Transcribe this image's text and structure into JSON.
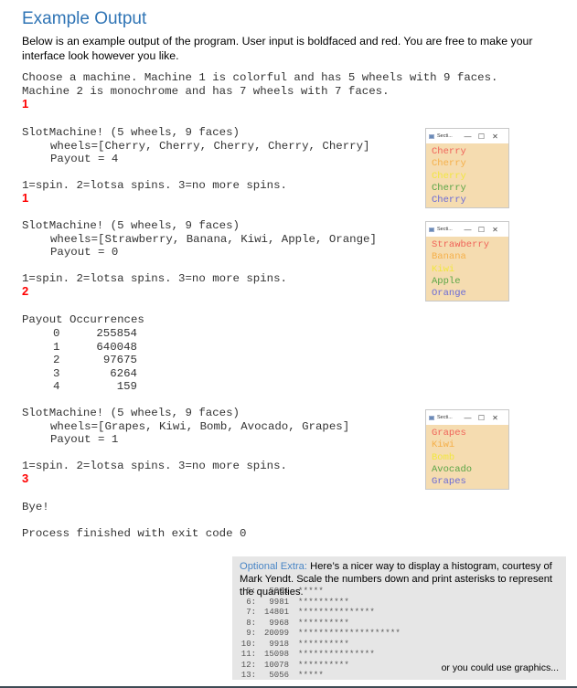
{
  "heading": "Example Output",
  "intro": "Below is an example output of the program. User input is boldfaced and red. You are free to make your interface look however you like.",
  "console": {
    "choose_line1": "Choose a machine. Machine 1 is colorful and has 5 wheels with 9 faces.",
    "choose_line2": "Machine 2 is monochrome and has 7 wheels with 7 faces.",
    "choice_input": "1",
    "spins": [
      {
        "header": "SlotMachine! (5 wheels, 9 faces)",
        "wheels_line": "wheels=[Cherry, Cherry, Cherry, Cherry, Cherry]",
        "payout_line": "Payout = 4",
        "menu": "1=spin. 2=lotsa spins. 3=no more spins.",
        "input": "1"
      },
      {
        "header": "SlotMachine! (5 wheels, 9 faces)",
        "wheels_line": "wheels=[Strawberry, Banana, Kiwi, Apple, Orange]",
        "payout_line": "Payout = 0",
        "menu": "1=spin. 2=lotsa spins. 3=no more spins.",
        "input": "2"
      },
      {
        "header": "SlotMachine! (5 wheels, 9 faces)",
        "wheels_line": "wheels=[Grapes, Kiwi, Bomb, Avocado, Grapes]",
        "payout_line": "Payout = 1",
        "menu": "1=spin. 2=lotsa spins. 3=no more spins.",
        "input": "3"
      }
    ],
    "payout_table": {
      "header": "Payout Occurrences",
      "rows": [
        {
          "payout": "0",
          "occurrences": "255854"
        },
        {
          "payout": "1",
          "occurrences": "640048"
        },
        {
          "payout": "2",
          "occurrences": "97675"
        },
        {
          "payout": "3",
          "occurrences": "6264"
        },
        {
          "payout": "4",
          "occurrences": "159"
        }
      ]
    },
    "bye": "Bye!",
    "exit": "Process finished with exit code 0"
  },
  "windows": [
    {
      "title": "Secti...",
      "controls": {
        "minimize": "—",
        "maximize": "☐",
        "close": "✕"
      },
      "wheels": [
        "Cherry",
        "Cherry",
        "Cherry",
        "Cherry",
        "Cherry"
      ]
    },
    {
      "title": "Secti...",
      "controls": {
        "minimize": "—",
        "maximize": "☐",
        "close": "✕"
      },
      "wheels": [
        "Strawberry",
        "Banana",
        "Kiwi",
        "Apple",
        "Orange"
      ]
    },
    {
      "title": "Secti...",
      "controls": {
        "minimize": "—",
        "maximize": "☐",
        "close": "✕"
      },
      "wheels": [
        "Grapes",
        "Kiwi",
        "Bomb",
        "Avocado",
        "Grapes"
      ]
    }
  ],
  "wheel_colors": [
    "#f0645a",
    "#f5b04a",
    "#f2e640",
    "#5aa546",
    "#6a6ad6"
  ],
  "optional_extra": {
    "label": "Optional Extra:",
    "text": " Here’s a nicer way to display a histogram, courtesy of Mark Yendt. Scale the numbers down and print asterisks to represent the quantities.",
    "histogram": [
      {
        "key": "5:",
        "value": "5001",
        "bar": "*****"
      },
      {
        "key": "6:",
        "value": "9981",
        "bar": "**********"
      },
      {
        "key": "7:",
        "value": "14801",
        "bar": "***************"
      },
      {
        "key": "8:",
        "value": "9968",
        "bar": "**********"
      },
      {
        "key": "9:",
        "value": "20099",
        "bar": "********************"
      },
      {
        "key": "10:",
        "value": "9918",
        "bar": "**********"
      },
      {
        "key": "11:",
        "value": "15098",
        "bar": "***************"
      },
      {
        "key": "12:",
        "value": "10078",
        "bar": "**********"
      },
      {
        "key": "13:",
        "value": "5056",
        "bar": "*****"
      }
    ],
    "graphics_note": "or you could use graphics..."
  }
}
